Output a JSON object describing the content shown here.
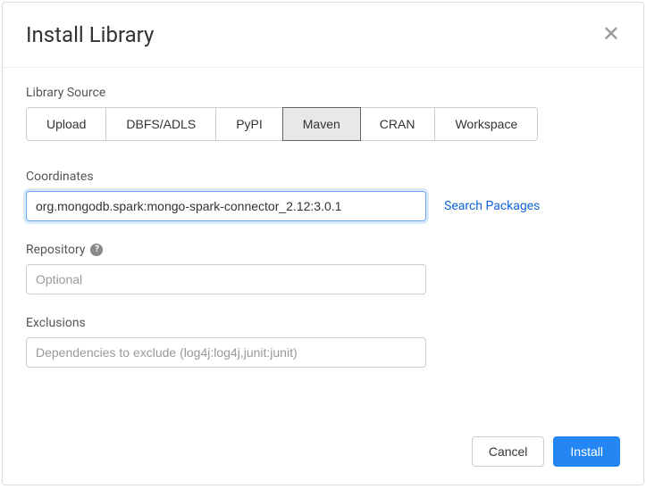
{
  "modal": {
    "title": "Install Library"
  },
  "librarySource": {
    "label": "Library Source",
    "tabs": [
      "Upload",
      "DBFS/ADLS",
      "PyPI",
      "Maven",
      "CRAN",
      "Workspace"
    ],
    "activeIndex": 3
  },
  "coordinates": {
    "label": "Coordinates",
    "value": "org.mongodb.spark:mongo-spark-connector_2.12:3.0.1",
    "searchLink": "Search Packages"
  },
  "repository": {
    "label": "Repository",
    "placeholder": "Optional"
  },
  "exclusions": {
    "label": "Exclusions",
    "placeholder": "Dependencies to exclude (log4j:log4j,junit:junit)"
  },
  "footer": {
    "cancel": "Cancel",
    "install": "Install"
  }
}
